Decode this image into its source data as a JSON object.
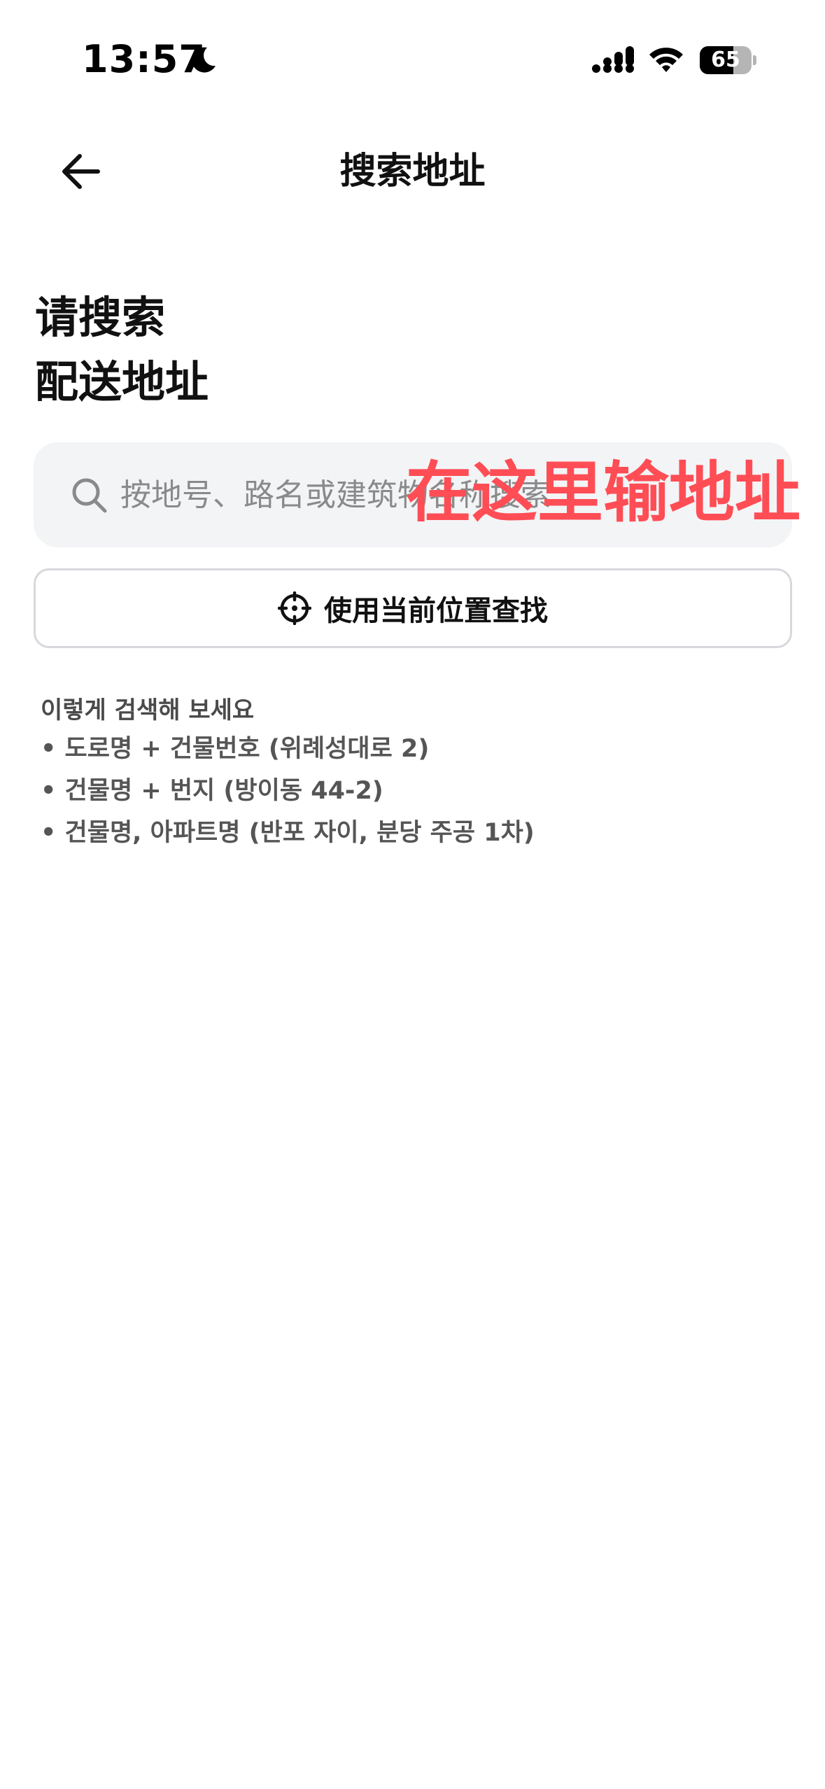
{
  "status_bar": {
    "time": "13:57",
    "battery_level": "65",
    "battery_fraction": 0.65
  },
  "nav": {
    "title": "搜索地址",
    "back_icon": "arrow-left-icon"
  },
  "heading": {
    "line1": "请搜索",
    "line2": "配送地址"
  },
  "search": {
    "placeholder": "按地号、路名或建筑物名称搜索",
    "value": "",
    "annotation": "在这里输地址",
    "annotation_color": "#ff4d55"
  },
  "location_button": {
    "label": "使用当前位置查找",
    "icon": "crosshair-icon"
  },
  "tips": {
    "title": "이렇게 검색해 보세요",
    "items": [
      "• 도로명 + 건물번호 (위례성대로 2)",
      "• 건물명 + 번지 (방이동 44-2)",
      "• 건물명, 아파트명 (반포 자이, 분당 주공 1차)"
    ]
  }
}
